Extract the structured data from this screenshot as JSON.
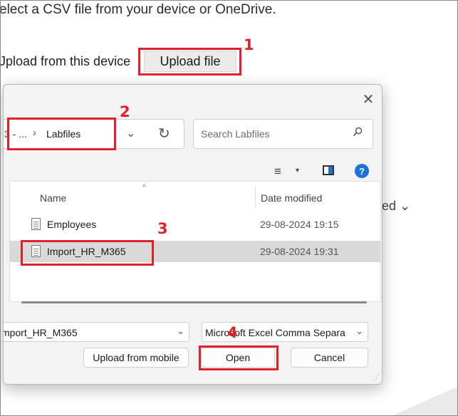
{
  "background": {
    "instruction": "elect a CSV file from your device or OneDrive.",
    "upload_label": "Jpload from this device",
    "upload_button": "Upload file",
    "column_partial": "ified ⌄"
  },
  "dialog": {
    "close_glyph": "✕",
    "address": {
      "truncated": "3 - ...",
      "separator": "›",
      "folder": "Labfiles",
      "dropdown_glyph": "⌄",
      "refresh_glyph": "↻"
    },
    "search": {
      "placeholder": "Search Labfiles"
    },
    "toolbar": {
      "view_glyph": "≡",
      "dropdown_glyph": "▾",
      "help_glyph": "?"
    },
    "columns": {
      "name": "Name",
      "sort_glyph": "^",
      "date_modified": "Date modified"
    },
    "files": [
      {
        "name": "Employees",
        "date": "29-08-2024 19:15",
        "selected": false
      },
      {
        "name": "Import_HR_M365",
        "date": "29-08-2024 19:31",
        "selected": true
      }
    ],
    "file_name_value": "mport_HR_M365",
    "file_type_value": "Microsoft Excel Comma Separa",
    "dropdown_glyph": "⌄",
    "buttons": {
      "upload_mobile": "Upload from mobile",
      "open": "Open",
      "cancel": "Cancel"
    },
    "grip_glyph": "⋰"
  },
  "annotations": {
    "color": "#e0202b",
    "steps": [
      "1",
      "2",
      "3",
      "4"
    ]
  }
}
